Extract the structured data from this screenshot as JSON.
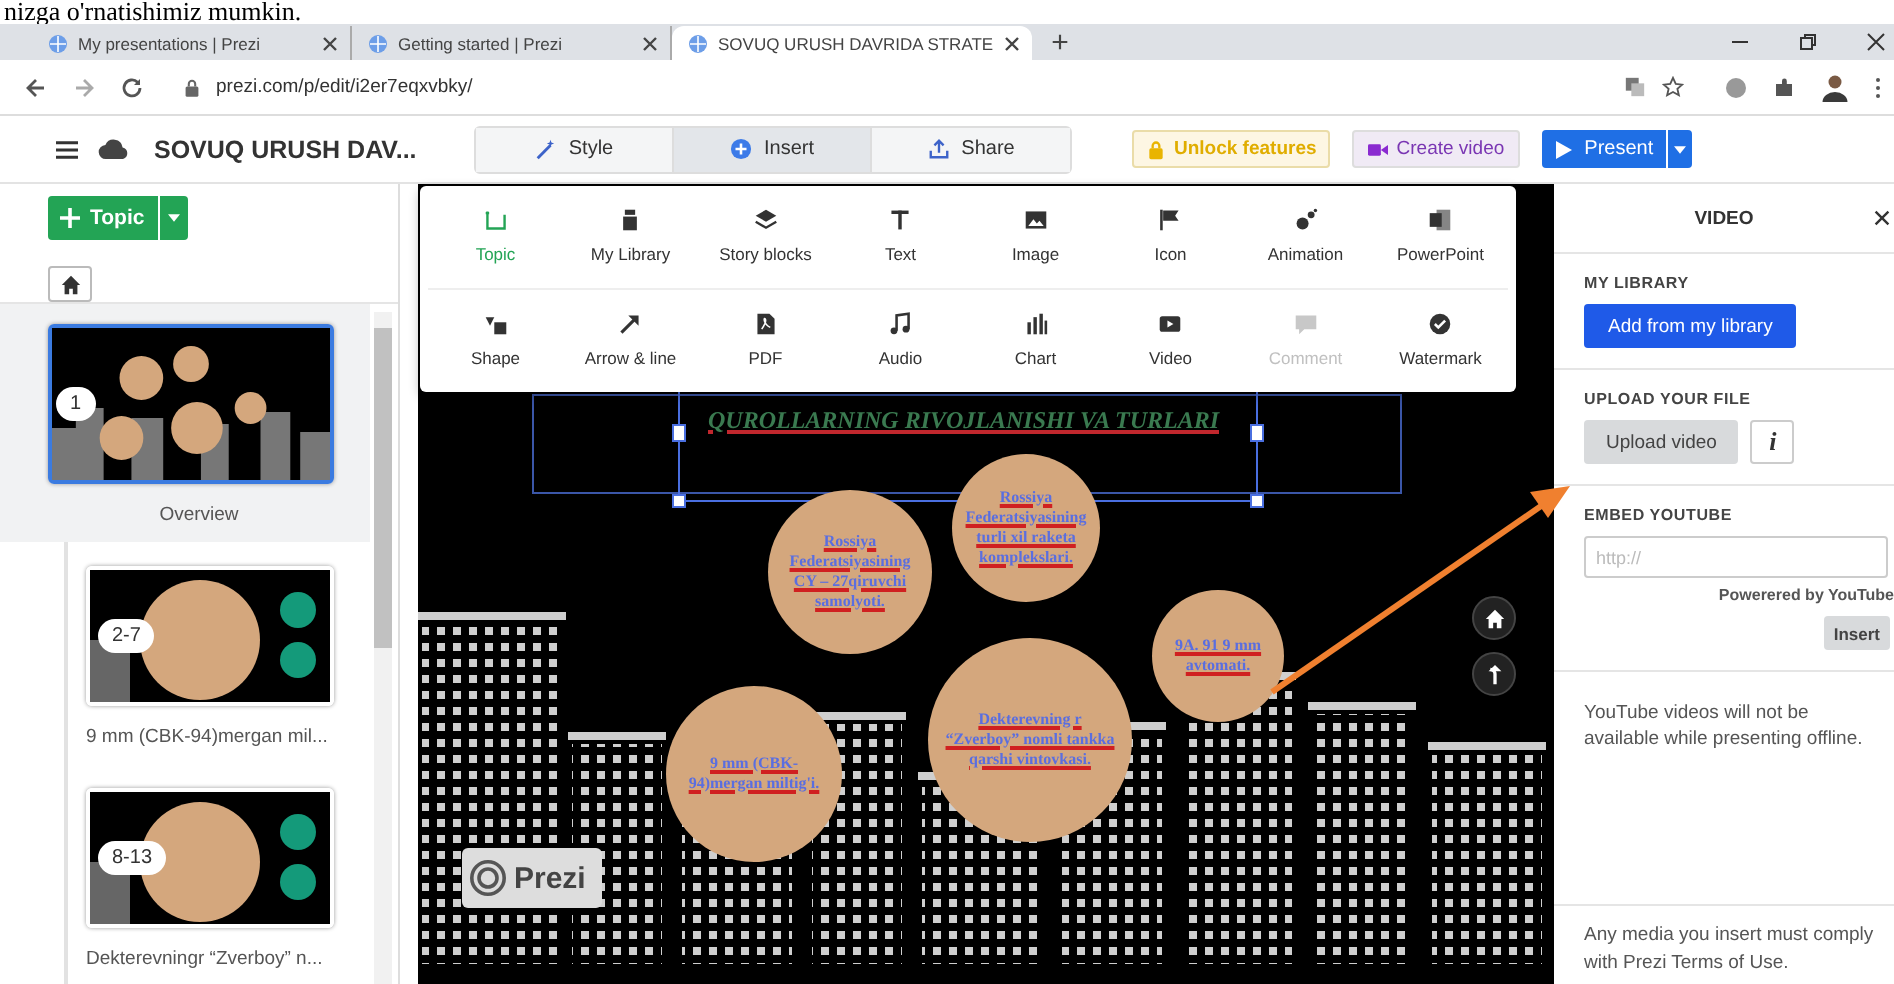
{
  "doc_text": "nizga o'rnatishimiz mumkin.",
  "browser": {
    "tabs": [
      {
        "title": "My presentations | Prezi",
        "selected": false
      },
      {
        "title": "Getting started | Prezi",
        "selected": false
      },
      {
        "title": "SOVUQ URUSH DAVRIDA STRATE",
        "selected": true
      }
    ],
    "new_tab": "+",
    "url": "prezi.com/p/edit/i2er7eqxvbky/"
  },
  "toolbar": {
    "title": "SOVUQ URUSH DAV...",
    "modes": [
      {
        "label": "Style",
        "kind": "style",
        "selected": false
      },
      {
        "label": "Insert",
        "kind": "insert",
        "selected": true
      },
      {
        "label": "Share",
        "kind": "share",
        "selected": false
      }
    ],
    "unlock": "Unlock features",
    "create_video": "Create video",
    "present": "Present"
  },
  "insert_menu": [
    {
      "label": "Topic",
      "kind": "topic",
      "selected": true,
      "disabled": false
    },
    {
      "label": "My Library",
      "kind": "library",
      "selected": false,
      "disabled": false
    },
    {
      "label": "Story blocks",
      "kind": "blocks",
      "selected": false,
      "disabled": false
    },
    {
      "label": "Text",
      "kind": "text",
      "selected": false,
      "disabled": false
    },
    {
      "label": "Image",
      "kind": "image",
      "selected": false,
      "disabled": false
    },
    {
      "label": "Icon",
      "kind": "icon",
      "selected": false,
      "disabled": false
    },
    {
      "label": "Animation",
      "kind": "animation",
      "selected": false,
      "disabled": false
    },
    {
      "label": "PowerPoint",
      "kind": "powerpoint",
      "selected": false,
      "disabled": false
    },
    {
      "label": "Shape",
      "kind": "shape",
      "selected": false,
      "disabled": false
    },
    {
      "label": "Arrow & line",
      "kind": "arrow",
      "selected": false,
      "disabled": false
    },
    {
      "label": "PDF",
      "kind": "pdf",
      "selected": false,
      "disabled": false
    },
    {
      "label": "Audio",
      "kind": "audio",
      "selected": false,
      "disabled": false
    },
    {
      "label": "Chart",
      "kind": "chart",
      "selected": false,
      "disabled": false
    },
    {
      "label": "Video",
      "kind": "video",
      "selected": false,
      "disabled": false
    },
    {
      "label": "Comment",
      "kind": "comment",
      "selected": false,
      "disabled": true
    },
    {
      "label": "Watermark",
      "kind": "watermark",
      "selected": false,
      "disabled": false
    }
  ],
  "sidebar": {
    "topic_button": "Topic",
    "topics": [
      {
        "number": "1",
        "label": "Overview",
        "selected": true
      },
      {
        "number": "2-7",
        "label": "9 mm (CBK-94)mergan mil...",
        "selected": false
      },
      {
        "number": "8-13",
        "label": "Dekterevningr “Zverboy” n...",
        "selected": false
      }
    ]
  },
  "slide": {
    "title": "QUROLLARNING RIVOJLANISHI VA TURLARI",
    "circles": [
      "Rossiya Federatsiyasining CY – 27qiruvchi samolyoti.",
      "Rossiya Federatsiyasining turli xil raketa komplekslari.",
      "9A. 91 9 mm avtomati.",
      "Dekterevning r “Zverboy” nomli tankka qarshi vintovkasi.",
      "9 mm (CBK-94)mergan miltig'i."
    ],
    "logo": "Prezi"
  },
  "panel": {
    "title": "VIDEO",
    "library_heading": "MY LIBRARY",
    "library_button": "Add from my library",
    "upload_heading": "UPLOAD YOUR FILE",
    "upload_button": "Upload video",
    "info_button": "i",
    "embed_heading": "EMBED YOUTUBE",
    "url_placeholder": "http://",
    "powered": "Powerered by YouTube",
    "insert_button": "Insert",
    "offline_note": "YouTube videos will not be available while presenting offline.",
    "terms_note": "Any media you insert must comply with Prezi Terms of Use."
  }
}
